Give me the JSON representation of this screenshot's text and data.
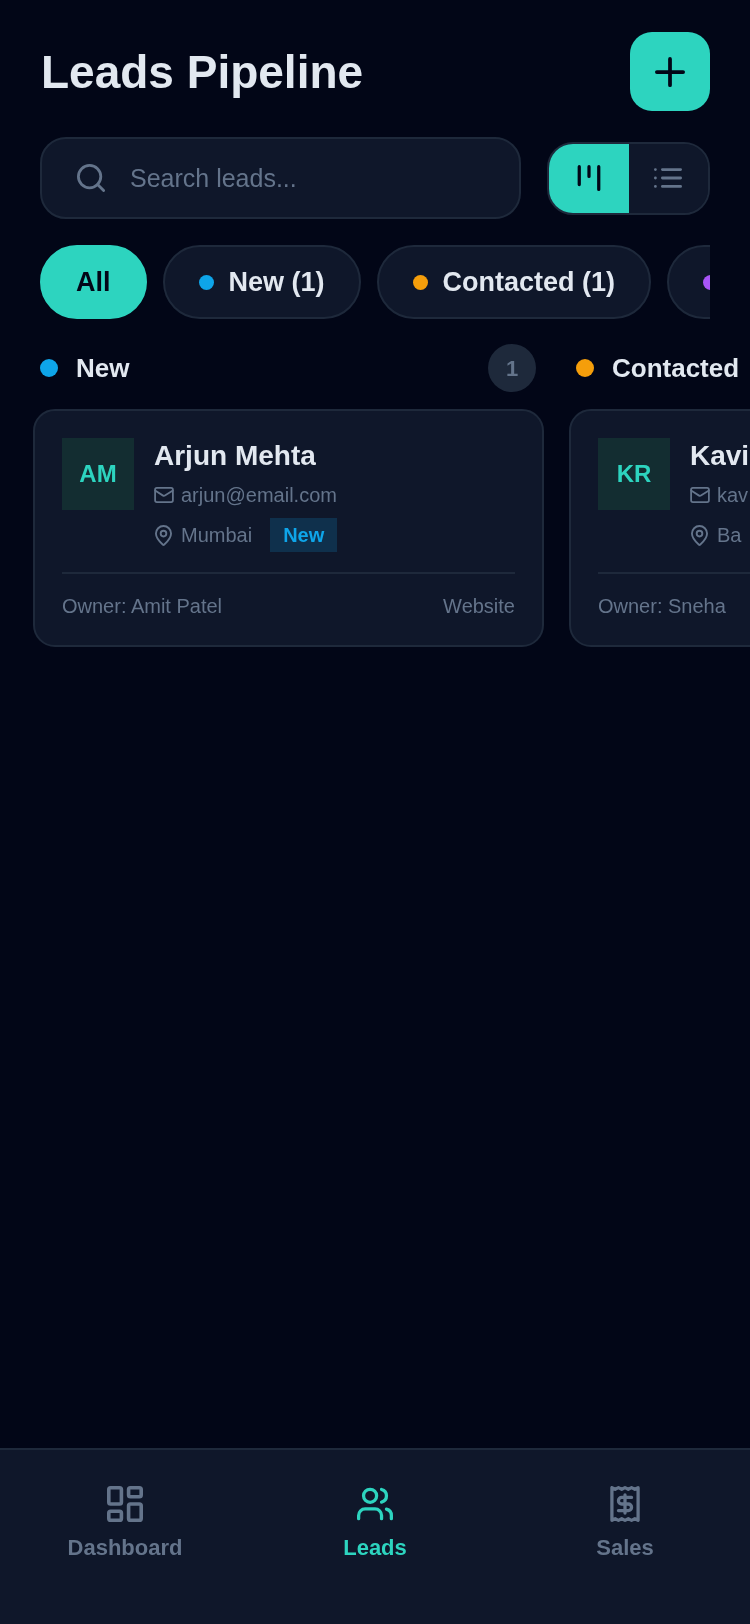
{
  "header": {
    "title": "Leads Pipeline"
  },
  "search": {
    "placeholder": "Search leads..."
  },
  "view_toggle": [
    {
      "kind": "kanban",
      "selected": true
    },
    {
      "kind": "list",
      "selected": false
    }
  ],
  "filters": [
    {
      "label": "All",
      "selected": true
    },
    {
      "label": "New (1)",
      "color": "#0ea5e9",
      "selected": false
    },
    {
      "label": "Contacted (1)",
      "color": "#f59e0b",
      "selected": false
    },
    {
      "color": "#a855f7",
      "selected": false
    }
  ],
  "columns": [
    {
      "title": "New",
      "color": "#0ea5e9",
      "count": "1",
      "cards": [
        {
          "initials": "AM",
          "name": "Arjun Mehta",
          "email": "arjun@email.com",
          "location": "Mumbai",
          "status": "New",
          "owner": "Owner: Amit Patel",
          "source": "Website"
        }
      ]
    },
    {
      "title": "Contacted",
      "color": "#f59e0b",
      "cards": [
        {
          "initials": "KR",
          "name": "Kavi",
          "email": "kav",
          "location": "Ba",
          "owner": "Owner: Sneha"
        }
      ]
    }
  ],
  "nav": [
    {
      "label": "Dashboard",
      "kind": "dashboard",
      "selected": false
    },
    {
      "label": "Leads",
      "kind": "users",
      "selected": true
    },
    {
      "label": "Sales",
      "kind": "receipt",
      "selected": false
    }
  ]
}
